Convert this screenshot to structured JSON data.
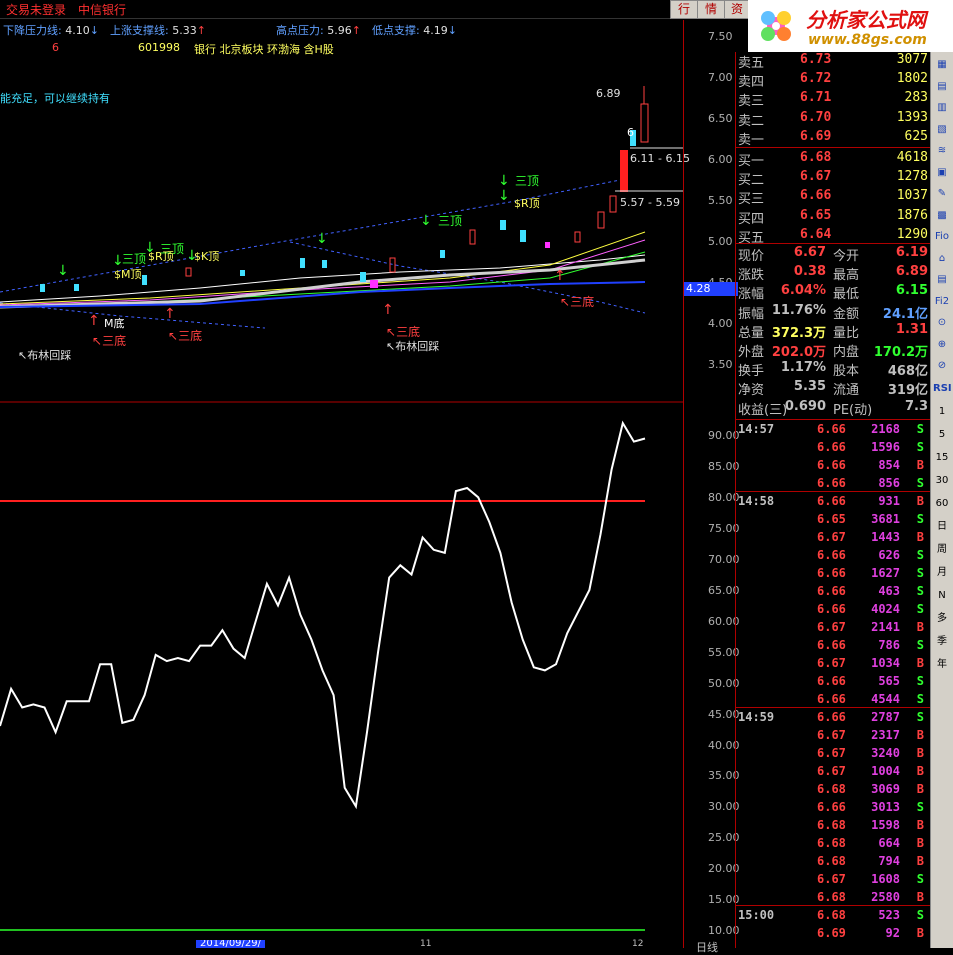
{
  "menubar": {
    "login": "交易未登录",
    "stock_name": "中信银行",
    "btn_quote": "行",
    "btn_info": "情",
    "btn_data": "资"
  },
  "logo": {
    "title": "分析家公式网",
    "url": "www.88gs.com"
  },
  "chart_header": {
    "down_line_label": "下降压力线:",
    "down_line_value": "4.10",
    "up_line_label": "上涨支撑线:",
    "up_line_value": "5.33",
    "high_label": "高点压力:",
    "high_value": "5.96",
    "low_label": "低点支撑:",
    "low_value": "4.19",
    "row2_left": "6",
    "code": "601998",
    "sectors": "银行 北京板块 环渤海 含H股",
    "note": "能充足，可以继续持有"
  },
  "price_axis": [
    "7.50",
    "7.00",
    "6.50",
    "6.00",
    "5.50",
    "5.00",
    "4.50",
    "4.00",
    "3.50"
  ],
  "price_marker": "4.28",
  "indicator_axis": [
    "90.00",
    "85.00",
    "80.00",
    "75.00",
    "70.00",
    "65.00",
    "60.00",
    "55.00",
    "50.00",
    "45.00",
    "40.00",
    "35.00",
    "30.00",
    "25.00",
    "20.00",
    "15.00",
    "10.00"
  ],
  "annotations": {
    "sanding": "三顶",
    "sanding2": "三顶",
    "sanding3": "三顶",
    "sanding4": "三顶",
    "r_top": "$R顶",
    "r_top2": "$R顶",
    "k_top": "$K顶",
    "m_top": "$M顶",
    "m_bottom": "M底",
    "sandi": "三底",
    "sandi2": "三底",
    "sandi3": "三底",
    "sandi4": "三底",
    "bollinger": "布林回踩",
    "bollinger2": "布林回踩",
    "high_price": "6.89",
    "range1": "6.11 - 6.15",
    "range2": "5.57 - 5.59",
    "sixcap": "6"
  },
  "bottom": {
    "date": "2014/09/29/",
    "period": "日线",
    "mark11": "11",
    "mark12": "12"
  },
  "order_book": [
    {
      "label": "卖五",
      "price": "6.73",
      "vol": "3077"
    },
    {
      "label": "卖四",
      "price": "6.72",
      "vol": "1802"
    },
    {
      "label": "卖三",
      "price": "6.71",
      "vol": "283"
    },
    {
      "label": "卖二",
      "price": "6.70",
      "vol": "1393"
    },
    {
      "label": "卖一",
      "price": "6.69",
      "vol": "625"
    },
    {
      "label": "买一",
      "price": "6.68",
      "vol": "4618"
    },
    {
      "label": "买二",
      "price": "6.67",
      "vol": "1278"
    },
    {
      "label": "买三",
      "price": "6.66",
      "vol": "1037"
    },
    {
      "label": "买四",
      "price": "6.65",
      "vol": "1876"
    },
    {
      "label": "买五",
      "price": "6.64",
      "vol": "1290"
    }
  ],
  "stats": [
    {
      "l1": "现价",
      "v1": "6.67",
      "l2": "今开",
      "v2": "6.19",
      "c1": "#ff4040",
      "c2": "#ff4040"
    },
    {
      "l1": "涨跌",
      "v1": "0.38",
      "l2": "最高",
      "v2": "6.89",
      "c1": "#ff4040",
      "c2": "#ff4040"
    },
    {
      "l1": "涨幅",
      "v1": "6.04%",
      "l2": "最低",
      "v2": "6.15",
      "c1": "#ff4040",
      "c2": "#30ff30"
    },
    {
      "l1": "振幅",
      "v1": "11.76%",
      "l2": "金额",
      "v2": "24.1亿",
      "c1": "#c0c0c0",
      "c2": "#60a0ff"
    },
    {
      "l1": "总量",
      "v1": "372.3万",
      "l2": "量比",
      "v2": "1.31",
      "c1": "#ffff60",
      "c2": "#ff4040"
    },
    {
      "l1": "外盘",
      "v1": "202.0万",
      "l2": "内盘",
      "v2": "170.2万",
      "c1": "#ff4040",
      "c2": "#30ff30"
    },
    {
      "l1": "换手",
      "v1": "1.17%",
      "l2": "股本",
      "v2": "468亿",
      "c1": "#c0c0c0",
      "c2": "#c0c0c0"
    },
    {
      "l1": "净资",
      "v1": "5.35",
      "l2": "流通",
      "v2": "319亿",
      "c1": "#c0c0c0",
      "c2": "#c0c0c0"
    },
    {
      "l1": "收益(三)",
      "v1": "0.690",
      "l2": "PE(动)",
      "v2": "7.3",
      "c1": "#c0c0c0",
      "c2": "#c0c0c0"
    }
  ],
  "ticks": [
    {
      "t": "14:57",
      "p": "6.66",
      "v": "2168",
      "d": "S",
      "pc": "#ff4040",
      "dc": "#30ff30"
    },
    {
      "t": "",
      "p": "6.66",
      "v": "1596",
      "d": "S",
      "pc": "#ff4040",
      "dc": "#30ff30"
    },
    {
      "t": "",
      "p": "6.66",
      "v": "854",
      "d": "B",
      "pc": "#ff4040",
      "dc": "#ff4040"
    },
    {
      "t": "",
      "p": "6.66",
      "v": "856",
      "d": "S",
      "pc": "#ff4040",
      "dc": "#30ff30"
    },
    {
      "t": "14:58",
      "p": "6.66",
      "v": "931",
      "d": "B",
      "pc": "#ff4040",
      "dc": "#ff4040"
    },
    {
      "t": "",
      "p": "6.65",
      "v": "3681",
      "d": "S",
      "pc": "#ff4040",
      "dc": "#30ff30"
    },
    {
      "t": "",
      "p": "6.67",
      "v": "1443",
      "d": "B",
      "pc": "#ff4040",
      "dc": "#ff4040"
    },
    {
      "t": "",
      "p": "6.66",
      "v": "626",
      "d": "S",
      "pc": "#ff4040",
      "dc": "#30ff30"
    },
    {
      "t": "",
      "p": "6.66",
      "v": "1627",
      "d": "S",
      "pc": "#ff4040",
      "dc": "#30ff30"
    },
    {
      "t": "",
      "p": "6.66",
      "v": "463",
      "d": "S",
      "pc": "#ff4040",
      "dc": "#30ff30"
    },
    {
      "t": "",
      "p": "6.66",
      "v": "4024",
      "d": "S",
      "pc": "#ff4040",
      "dc": "#30ff30"
    },
    {
      "t": "",
      "p": "6.67",
      "v": "2141",
      "d": "B",
      "pc": "#ff4040",
      "dc": "#ff4040"
    },
    {
      "t": "",
      "p": "6.66",
      "v": "786",
      "d": "S",
      "pc": "#ff4040",
      "dc": "#30ff30"
    },
    {
      "t": "",
      "p": "6.67",
      "v": "1034",
      "d": "B",
      "pc": "#ff4040",
      "dc": "#ff4040"
    },
    {
      "t": "",
      "p": "6.66",
      "v": "565",
      "d": "S",
      "pc": "#ff4040",
      "dc": "#30ff30"
    },
    {
      "t": "",
      "p": "6.66",
      "v": "4544",
      "d": "S",
      "pc": "#ff4040",
      "dc": "#30ff30"
    },
    {
      "t": "14:59",
      "p": "6.66",
      "v": "2787",
      "d": "S",
      "pc": "#ff4040",
      "dc": "#30ff30"
    },
    {
      "t": "",
      "p": "6.67",
      "v": "2317",
      "d": "B",
      "pc": "#ff4040",
      "dc": "#ff4040"
    },
    {
      "t": "",
      "p": "6.67",
      "v": "3240",
      "d": "B",
      "pc": "#ff4040",
      "dc": "#ff4040"
    },
    {
      "t": "",
      "p": "6.67",
      "v": "1004",
      "d": "B",
      "pc": "#ff4040",
      "dc": "#ff4040"
    },
    {
      "t": "",
      "p": "6.68",
      "v": "3069",
      "d": "B",
      "pc": "#ff4040",
      "dc": "#ff4040"
    },
    {
      "t": "",
      "p": "6.66",
      "v": "3013",
      "d": "S",
      "pc": "#ff4040",
      "dc": "#30ff30"
    },
    {
      "t": "",
      "p": "6.68",
      "v": "1598",
      "d": "B",
      "pc": "#ff4040",
      "dc": "#ff4040"
    },
    {
      "t": "",
      "p": "6.68",
      "v": "664",
      "d": "B",
      "pc": "#ff4040",
      "dc": "#ff4040"
    },
    {
      "t": "",
      "p": "6.68",
      "v": "794",
      "d": "B",
      "pc": "#ff4040",
      "dc": "#ff4040"
    },
    {
      "t": "",
      "p": "6.67",
      "v": "1608",
      "d": "S",
      "pc": "#ff4040",
      "dc": "#30ff30"
    },
    {
      "t": "",
      "p": "6.68",
      "v": "2580",
      "d": "B",
      "pc": "#ff4040",
      "dc": "#ff4040"
    },
    {
      "t": "15:00",
      "p": "6.68",
      "v": "523",
      "d": "S",
      "pc": "#ff4040",
      "dc": "#30ff30"
    },
    {
      "t": "",
      "p": "6.69",
      "v": "92",
      "d": "B",
      "pc": "#ff4040",
      "dc": "#ff4040"
    }
  ],
  "toolbar": [
    "RSI",
    "1",
    "5",
    "15",
    "30",
    "60",
    "日",
    "周",
    "月",
    "N",
    "多",
    "季",
    "年"
  ],
  "chart_data": {
    "type": "line",
    "series": [
      {
        "values": [
          43,
          49,
          46,
          46.5,
          46,
          42,
          47,
          47,
          47,
          53,
          53,
          43.5,
          44,
          48,
          54.5,
          53.5,
          54,
          53.5,
          56,
          56,
          58.5,
          55.5,
          54,
          60,
          66,
          62.5,
          67,
          61,
          57,
          52,
          48,
          33,
          30,
          42,
          55,
          67,
          69,
          67.5,
          73.5,
          71.5,
          71,
          81,
          81.5,
          80,
          76,
          71,
          63,
          57,
          52.5,
          52,
          53,
          58,
          61.5,
          65,
          74,
          84.5,
          92,
          89,
          89.5
        ]
      }
    ],
    "ylim": [
      10,
      92.5
    ],
    "reference_line": 80
  }
}
